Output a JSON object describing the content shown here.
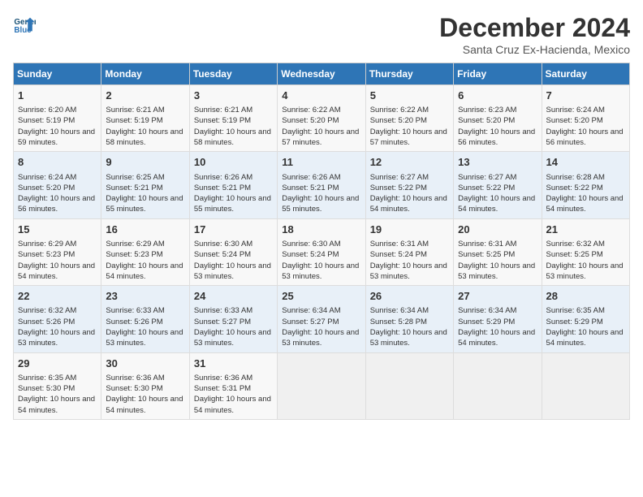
{
  "header": {
    "logo_line1": "General",
    "logo_line2": "Blue",
    "month": "December 2024",
    "location": "Santa Cruz Ex-Hacienda, Mexico"
  },
  "days_of_week": [
    "Sunday",
    "Monday",
    "Tuesday",
    "Wednesday",
    "Thursday",
    "Friday",
    "Saturday"
  ],
  "weeks": [
    [
      {
        "day": 1,
        "sunrise": "6:20 AM",
        "sunset": "5:19 PM",
        "daylight": "10 hours and 59 minutes."
      },
      {
        "day": 2,
        "sunrise": "6:21 AM",
        "sunset": "5:19 PM",
        "daylight": "10 hours and 58 minutes."
      },
      {
        "day": 3,
        "sunrise": "6:21 AM",
        "sunset": "5:19 PM",
        "daylight": "10 hours and 58 minutes."
      },
      {
        "day": 4,
        "sunrise": "6:22 AM",
        "sunset": "5:20 PM",
        "daylight": "10 hours and 57 minutes."
      },
      {
        "day": 5,
        "sunrise": "6:22 AM",
        "sunset": "5:20 PM",
        "daylight": "10 hours and 57 minutes."
      },
      {
        "day": 6,
        "sunrise": "6:23 AM",
        "sunset": "5:20 PM",
        "daylight": "10 hours and 56 minutes."
      },
      {
        "day": 7,
        "sunrise": "6:24 AM",
        "sunset": "5:20 PM",
        "daylight": "10 hours and 56 minutes."
      }
    ],
    [
      {
        "day": 8,
        "sunrise": "6:24 AM",
        "sunset": "5:20 PM",
        "daylight": "10 hours and 56 minutes."
      },
      {
        "day": 9,
        "sunrise": "6:25 AM",
        "sunset": "5:21 PM",
        "daylight": "10 hours and 55 minutes."
      },
      {
        "day": 10,
        "sunrise": "6:26 AM",
        "sunset": "5:21 PM",
        "daylight": "10 hours and 55 minutes."
      },
      {
        "day": 11,
        "sunrise": "6:26 AM",
        "sunset": "5:21 PM",
        "daylight": "10 hours and 55 minutes."
      },
      {
        "day": 12,
        "sunrise": "6:27 AM",
        "sunset": "5:22 PM",
        "daylight": "10 hours and 54 minutes."
      },
      {
        "day": 13,
        "sunrise": "6:27 AM",
        "sunset": "5:22 PM",
        "daylight": "10 hours and 54 minutes."
      },
      {
        "day": 14,
        "sunrise": "6:28 AM",
        "sunset": "5:22 PM",
        "daylight": "10 hours and 54 minutes."
      }
    ],
    [
      {
        "day": 15,
        "sunrise": "6:29 AM",
        "sunset": "5:23 PM",
        "daylight": "10 hours and 54 minutes."
      },
      {
        "day": 16,
        "sunrise": "6:29 AM",
        "sunset": "5:23 PM",
        "daylight": "10 hours and 54 minutes."
      },
      {
        "day": 17,
        "sunrise": "6:30 AM",
        "sunset": "5:24 PM",
        "daylight": "10 hours and 53 minutes."
      },
      {
        "day": 18,
        "sunrise": "6:30 AM",
        "sunset": "5:24 PM",
        "daylight": "10 hours and 53 minutes."
      },
      {
        "day": 19,
        "sunrise": "6:31 AM",
        "sunset": "5:24 PM",
        "daylight": "10 hours and 53 minutes."
      },
      {
        "day": 20,
        "sunrise": "6:31 AM",
        "sunset": "5:25 PM",
        "daylight": "10 hours and 53 minutes."
      },
      {
        "day": 21,
        "sunrise": "6:32 AM",
        "sunset": "5:25 PM",
        "daylight": "10 hours and 53 minutes."
      }
    ],
    [
      {
        "day": 22,
        "sunrise": "6:32 AM",
        "sunset": "5:26 PM",
        "daylight": "10 hours and 53 minutes."
      },
      {
        "day": 23,
        "sunrise": "6:33 AM",
        "sunset": "5:26 PM",
        "daylight": "10 hours and 53 minutes."
      },
      {
        "day": 24,
        "sunrise": "6:33 AM",
        "sunset": "5:27 PM",
        "daylight": "10 hours and 53 minutes."
      },
      {
        "day": 25,
        "sunrise": "6:34 AM",
        "sunset": "5:27 PM",
        "daylight": "10 hours and 53 minutes."
      },
      {
        "day": 26,
        "sunrise": "6:34 AM",
        "sunset": "5:28 PM",
        "daylight": "10 hours and 53 minutes."
      },
      {
        "day": 27,
        "sunrise": "6:34 AM",
        "sunset": "5:29 PM",
        "daylight": "10 hours and 54 minutes."
      },
      {
        "day": 28,
        "sunrise": "6:35 AM",
        "sunset": "5:29 PM",
        "daylight": "10 hours and 54 minutes."
      }
    ],
    [
      {
        "day": 29,
        "sunrise": "6:35 AM",
        "sunset": "5:30 PM",
        "daylight": "10 hours and 54 minutes."
      },
      {
        "day": 30,
        "sunrise": "6:36 AM",
        "sunset": "5:30 PM",
        "daylight": "10 hours and 54 minutes."
      },
      {
        "day": 31,
        "sunrise": "6:36 AM",
        "sunset": "5:31 PM",
        "daylight": "10 hours and 54 minutes."
      },
      null,
      null,
      null,
      null
    ]
  ]
}
